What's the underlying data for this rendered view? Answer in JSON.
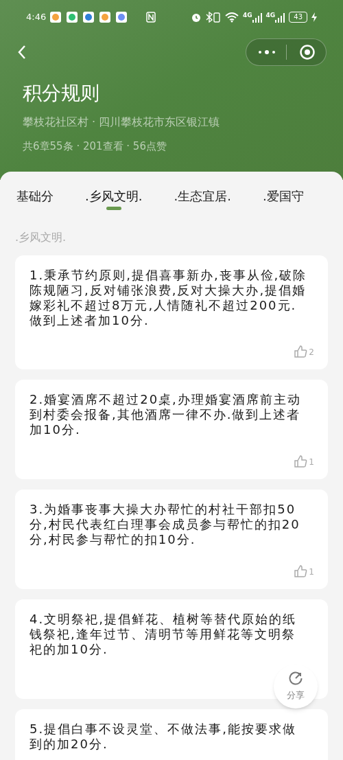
{
  "status_bar": {
    "time": "4:46",
    "network_1": "4G",
    "network_2": "4G",
    "battery": "43"
  },
  "header": {
    "title": "积分规则",
    "subtitle": "攀枝花社区村 · 四川攀枝花市东区银江镇",
    "stats": "共6章55条 · 201查看 · 56点赞"
  },
  "tabs": [
    {
      "label": "基础分",
      "selected": false
    },
    {
      "label": ".乡风文明.",
      "selected": true
    },
    {
      "label": ".生态宜居.",
      "selected": false
    },
    {
      "label": ".爱国守",
      "selected": false
    }
  ],
  "section_title": ".乡风文明.",
  "rules": [
    {
      "text": "1.秉承节约原则,提倡喜事新办,丧事从俭,破除陈规陋习,反对铺张浪费,反对大操大办,提倡婚嫁彩礼不超过8万元,人情随礼不超过200元.做到上述者加10分.",
      "likes": "2"
    },
    {
      "text": "2.婚宴酒席不超过20桌,办理婚宴酒席前主动到村委会报备,其他酒席一律不办.做到上述者加10分.",
      "likes": "1"
    },
    {
      "text": "3.为婚事丧事大操大办帮忙的村社干部扣50分,村民代表红白理事会成员参与帮忙的扣20分,村民参与帮忙的扣10分.",
      "likes": "1"
    },
    {
      "text": "4.文明祭祀,提倡鲜花、植树等替代原始的纸钱祭祀,逢年过节、清明节等用鲜花等文明祭祀的加10分."
    },
    {
      "text": "5.提倡白事不设灵堂、不做法事,能按要求做到的加20分."
    }
  ],
  "share_button": {
    "label": "分享"
  }
}
